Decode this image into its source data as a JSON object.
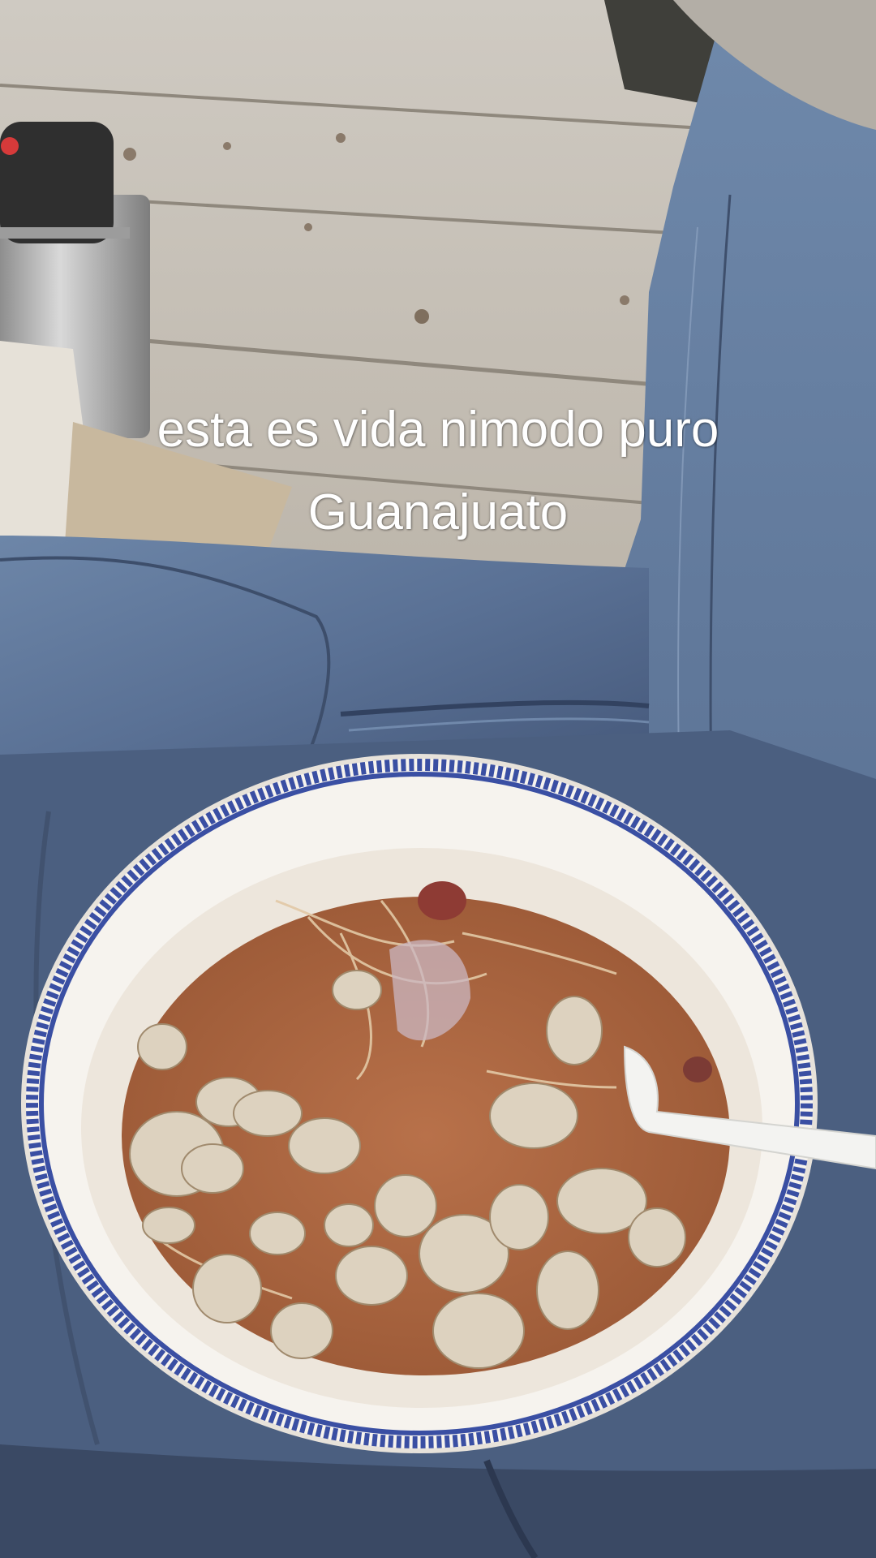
{
  "caption": {
    "line1": "esta es vida nimodo puro",
    "line2": "Guanajuato"
  },
  "colors": {
    "deck_wood": "#d6d2cb",
    "denim": "#5b7396",
    "denim_dark": "#3f526d",
    "bowl_rim_pattern": "#3a4fa3",
    "bowl_white": "#f4f1ec",
    "soup_broth": "#b46a44",
    "beans": "#d8cbb5",
    "thermos_cap": "#2b2b2b",
    "thermos_body": "#b8b8b8",
    "spoon": "#f2f2f2",
    "caption_text": "#ffffff"
  }
}
